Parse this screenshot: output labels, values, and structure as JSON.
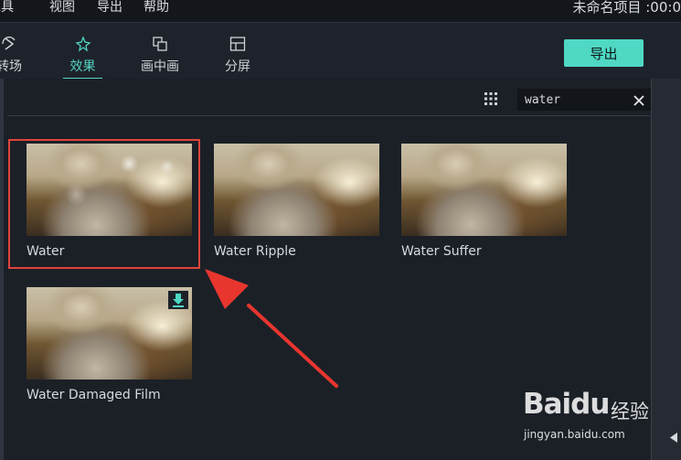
{
  "menu": [
    {
      "label": "工具"
    },
    {
      "label": "视图"
    },
    {
      "label": "导出"
    },
    {
      "label": "帮助"
    }
  ],
  "project_title": "未命名项目 :00:0",
  "tabs": [
    {
      "label": "转场",
      "icon": "transition-icon",
      "active": false
    },
    {
      "label": "效果",
      "icon": "effects-icon",
      "active": true
    },
    {
      "label": "画中画",
      "icon": "pip-icon",
      "active": false
    },
    {
      "label": "分屏",
      "icon": "split-screen-icon",
      "active": false
    }
  ],
  "export_label": "导出",
  "search": {
    "value": "water",
    "placeholder": ""
  },
  "effects": [
    {
      "label": "Water",
      "selected": true,
      "downloadable": false
    },
    {
      "label": "Water Ripple",
      "selected": false,
      "downloadable": false
    },
    {
      "label": "Water Suffer",
      "selected": false,
      "downloadable": false
    },
    {
      "label": "Water Damaged Film",
      "selected": false,
      "downloadable": true
    }
  ],
  "watermark": {
    "brand": "Baidu",
    "tag": "经验",
    "url": "jingyan.baidu.com"
  },
  "colors": {
    "accent": "#52d3c2",
    "export_button": "#4fd8c4",
    "highlight": "#e0443c",
    "background": "#1b2027"
  }
}
